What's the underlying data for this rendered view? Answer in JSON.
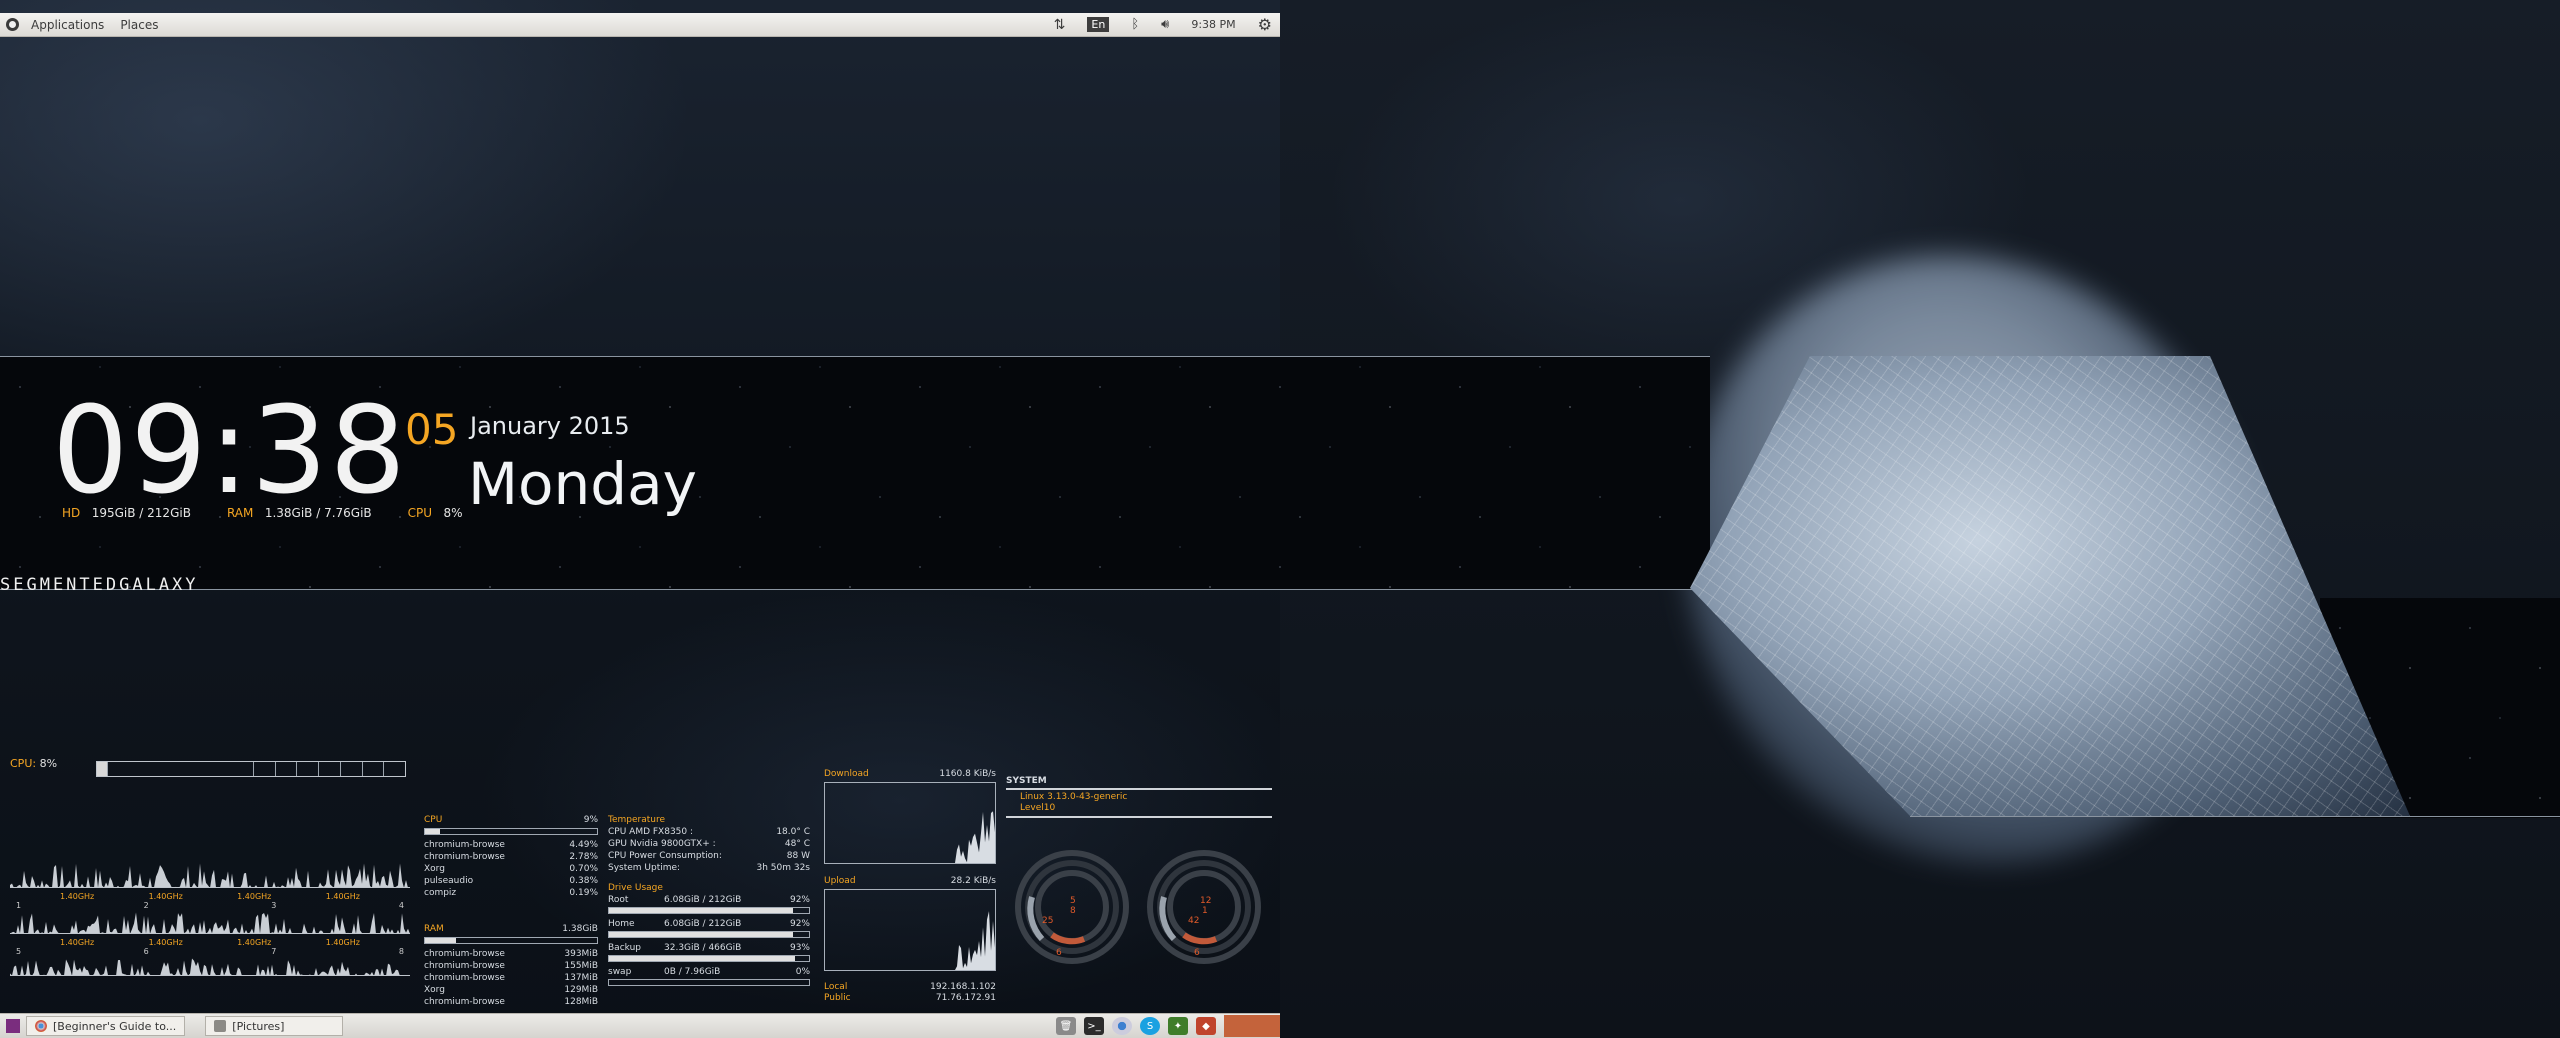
{
  "top_panel": {
    "menu_applications": "Applications",
    "menu_places": "Places",
    "keyboard_layout": "En",
    "clock": "9:38 PM"
  },
  "clock_widget": {
    "time": "09:38",
    "day_number": "05",
    "month_year": "January 2015",
    "weekday": "Monday",
    "stats": {
      "hd_label": "HD",
      "hd_value": "195GiB / 212GiB",
      "ram_label": "RAM",
      "ram_value": "1.38GiB / 7.76GiB",
      "cpu_label": "CPU",
      "cpu_value": "8%"
    },
    "brand": "SEGMENTEDGALAXY"
  },
  "cpu_overview": {
    "label": "CPU:",
    "value": "8%",
    "percent": 8,
    "core_freq": "1.40GHz",
    "cores": [
      "1",
      "2",
      "3",
      "4",
      "5",
      "6",
      "7",
      "8"
    ]
  },
  "processes": {
    "cpu_title": "CPU",
    "cpu_total": "9%",
    "cpu_percent": 9,
    "cpu_list": [
      {
        "name": "chromium-browse",
        "value": "4.49%"
      },
      {
        "name": "chromium-browse",
        "value": "2.78%"
      },
      {
        "name": "Xorg",
        "value": "0.70%"
      },
      {
        "name": "pulseaudio",
        "value": "0.38%"
      },
      {
        "name": "compiz",
        "value": "0.19%"
      }
    ],
    "ram_title": "RAM",
    "ram_total": "1.38GiB",
    "ram_percent": 18,
    "ram_list": [
      {
        "name": "chromium-browse",
        "value": "393MiB"
      },
      {
        "name": "chromium-browse",
        "value": "155MiB"
      },
      {
        "name": "chromium-browse",
        "value": "137MiB"
      },
      {
        "name": "Xorg",
        "value": "129MiB"
      },
      {
        "name": "chromium-browse",
        "value": "128MiB"
      }
    ]
  },
  "info": {
    "temp_title": "Temperature",
    "temps": [
      {
        "name": "CPU AMD FX8350 :",
        "value": "18.0° C"
      },
      {
        "name": "GPU Nvidia 9800GTX+ :",
        "value": "48° C"
      },
      {
        "name": "CPU Power Consumption:",
        "value": "88 W"
      },
      {
        "name": "System Uptime:",
        "value": "3h 50m 32s"
      }
    ],
    "drive_title": "Drive Usage",
    "drives": [
      {
        "name": "Root",
        "usage": "6.08GiB / 212GiB",
        "pct": "92%",
        "percent": 92
      },
      {
        "name": "Home",
        "usage": "6.08GiB / 212GiB",
        "pct": "92%",
        "percent": 92
      },
      {
        "name": "Backup",
        "usage": "32.3GiB / 466GiB",
        "pct": "93%",
        "percent": 93
      },
      {
        "name": "swap",
        "usage": "0B   / 7.96GiB",
        "pct": "0%",
        "percent": 0
      }
    ]
  },
  "network": {
    "download_label": "Download",
    "download_value": "1160.8 KiB/s",
    "upload_label": "Upload",
    "upload_value": "28.2 KiB/s",
    "local_label": "Local",
    "local_value": "192.168.1.102",
    "public_label": "Public",
    "public_value": "71.76.172.91"
  },
  "system": {
    "title": "SYSTEM",
    "kernel": "Linux 3.13.0-43-generic",
    "user": "Level10",
    "gauge_left": {
      "top": "5",
      "mid": "8",
      "low": "25",
      "bottom": "6"
    },
    "gauge_right": {
      "top": "12",
      "mid": "1",
      "low": "42",
      "bottom": "6"
    }
  },
  "bottom_panel": {
    "task1": "[Beginner's Guide to...",
    "task2": "[Pictures]"
  },
  "colors": {
    "accent": "#f5a623",
    "panel": "#e4e2de"
  }
}
